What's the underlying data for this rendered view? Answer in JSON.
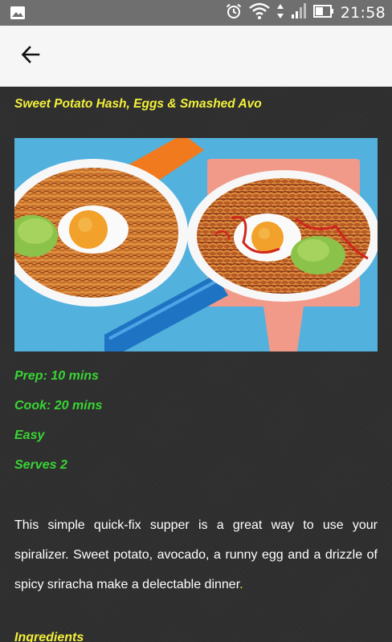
{
  "status_bar": {
    "time": "21:58",
    "icons": [
      "image-notification-icon",
      "alarm-icon",
      "wifi-icon",
      "data-arrows-icon",
      "signal-icon",
      "battery-icon"
    ]
  },
  "app_bar": {
    "back_icon": "arrow-left-icon"
  },
  "recipe": {
    "title": "Sweet Potato Hash, Eggs & Smashed Avo",
    "prep": "Prep: 10 mins",
    "cook": "Cook: 20 mins",
    "difficulty": "Easy",
    "serves": "Serves 2",
    "description": "This simple quick-fix supper is a great way to use your spiralizer. Sweet potato, avocado, a runny egg and a drizzle of spicy sriracha make a delectable dinner",
    "description_end": ".",
    "ingredients_heading": "Ingredients"
  },
  "colors": {
    "title": "#f3f03a",
    "meta": "#38d534",
    "body_text": "#ffffff",
    "background": "#2e2e2e",
    "app_bar": "#f6f6f6",
    "status_bar": "#6f6f6f"
  }
}
